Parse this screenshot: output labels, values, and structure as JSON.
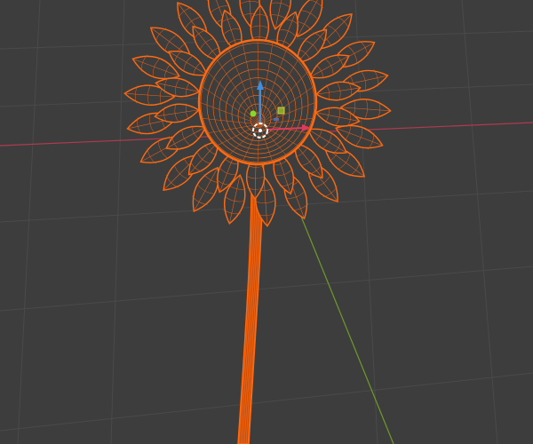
{
  "viewport": {
    "background": "#3d3d3d",
    "grid_color": "#4a4a4a",
    "x_axis_color": "#b03a50",
    "y_axis_color": "#6f9a2a",
    "wire_color": "#ff6a10",
    "wire_dim_color": "#e0601a",
    "petal_count_outer": 22,
    "petal_count_inner": 18
  },
  "gizmo": {
    "z_arrow_color": "#3f8fe0",
    "x_arrow_color": "#e03a5a",
    "y_handle_color": "#8ad62a",
    "plane_handle_color": "#8aa52a",
    "pivot_color": "#ffffff"
  }
}
